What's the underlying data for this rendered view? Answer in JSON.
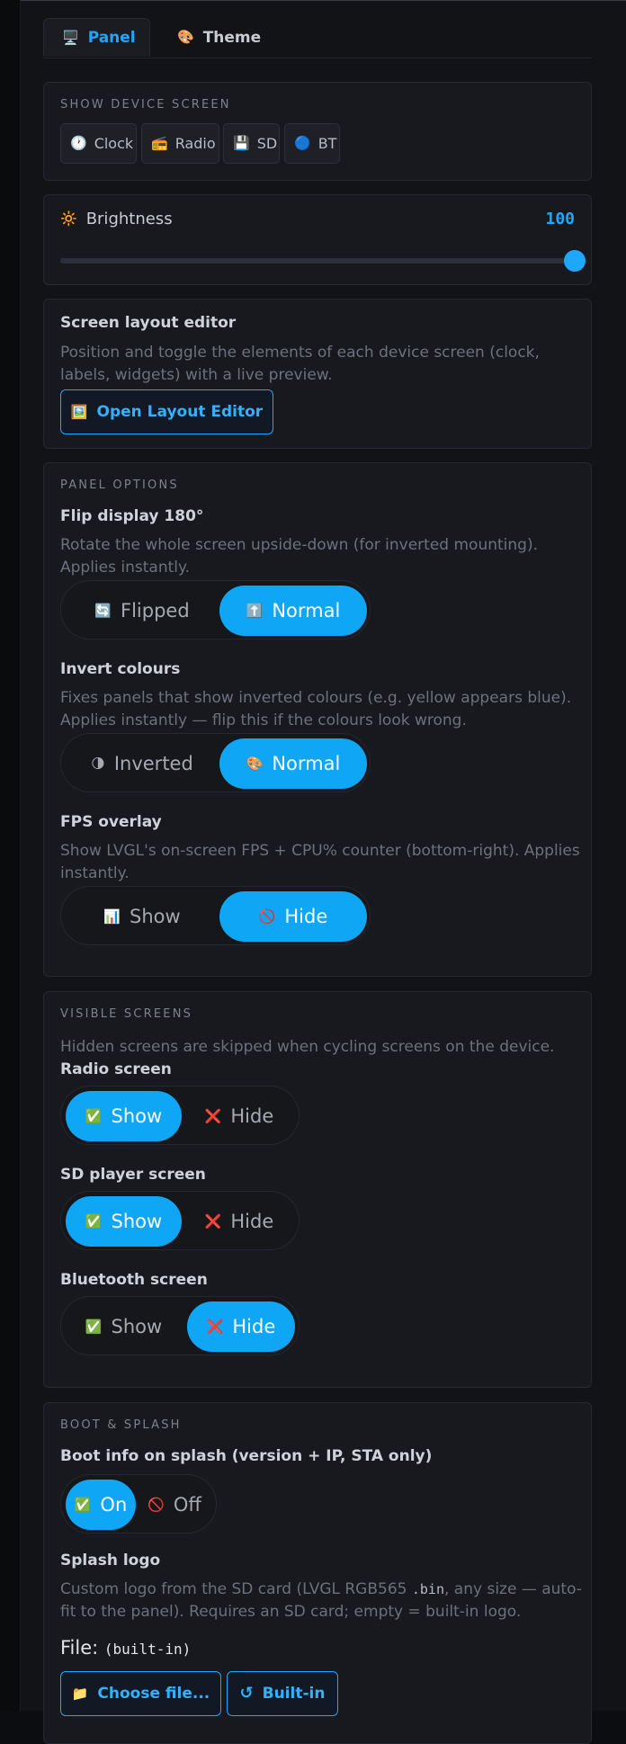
{
  "tabs": [
    {
      "label": "Panel",
      "icon": "monitor-icon",
      "glyph": "🖥️",
      "active": true
    },
    {
      "label": "Theme",
      "icon": "palette-icon",
      "glyph": "🎨",
      "active": false
    }
  ],
  "show_device_screen": {
    "title": "SHOW DEVICE SCREEN",
    "buttons": [
      {
        "label": "Clock",
        "icon": "clock-icon",
        "glyph": "🕐"
      },
      {
        "label": "Radio",
        "icon": "radio-icon",
        "glyph": "📻"
      },
      {
        "label": "SD",
        "icon": "floppy-icon",
        "glyph": "💾"
      },
      {
        "label": "BT",
        "icon": "blue-circle-icon",
        "glyph": "🔵"
      }
    ]
  },
  "brightness": {
    "label": "Brightness",
    "glyph": "🔆",
    "value": "100",
    "min": 0,
    "max": 100,
    "current": 100
  },
  "layout_editor": {
    "title": "Screen layout editor",
    "description": "Position and toggle the elements of each device screen (clock, labels, widgets) with a live preview.",
    "button": "Open Layout Editor",
    "button_glyph": "🖼️"
  },
  "panel_options": {
    "title": "PANEL OPTIONS",
    "flip": {
      "label": "Flip display 180°",
      "description": "Rotate the whole screen upside-down (for inverted mounting). Applies instantly.",
      "options": [
        {
          "label": "Flipped",
          "glyph": "🔄",
          "active": false
        },
        {
          "label": "Normal",
          "glyph": "⬆️",
          "active": true
        }
      ]
    },
    "invert": {
      "label": "Invert colours",
      "description": "Fixes panels that show inverted colours (e.g. yellow appears blue). Applies instantly — flip this if the colours look wrong.",
      "options": [
        {
          "label": "Inverted",
          "glyph": "🌗",
          "active": false
        },
        {
          "label": "Normal",
          "glyph": "🎨",
          "active": true
        }
      ]
    },
    "fps": {
      "label": "FPS overlay",
      "description": "Show LVGL's on-screen FPS + CPU% counter (bottom-right). Applies instantly.",
      "options": [
        {
          "label": "Show",
          "glyph": "📊",
          "active": false
        },
        {
          "label": "Hide",
          "glyph": "🚫",
          "active": true
        }
      ]
    }
  },
  "visible_screens": {
    "title": "VISIBLE SCREENS",
    "description": "Hidden screens are skipped when cycling screens on the device.",
    "radio": {
      "label": "Radio screen",
      "options": [
        {
          "label": "Show",
          "glyph": "✅",
          "active": true
        },
        {
          "label": "Hide",
          "glyph": "❌",
          "active": false
        }
      ]
    },
    "sd": {
      "label": "SD player screen",
      "options": [
        {
          "label": "Show",
          "glyph": "✅",
          "active": true
        },
        {
          "label": "Hide",
          "glyph": "❌",
          "active": false
        }
      ]
    },
    "bt": {
      "label": "Bluetooth screen",
      "options": [
        {
          "label": "Show",
          "glyph": "✅",
          "active": false
        },
        {
          "label": "Hide",
          "glyph": "❌",
          "active": true
        }
      ]
    }
  },
  "boot": {
    "title": "BOOT & SPLASH",
    "info_label": "Boot info on splash (version + IP, STA only)",
    "info_options": [
      {
        "label": "On",
        "glyph": "✅",
        "active": true
      },
      {
        "label": "Off",
        "glyph": "🚫",
        "active": false
      }
    ],
    "logo_label": "Splash logo",
    "logo_desc_before": "Custom logo from the SD card (LVGL RGB565 ",
    "logo_desc_code": ".bin",
    "logo_desc_after": ", any size — auto-fit to the panel). Requires an SD card; empty = built-in logo.",
    "file_label": "File:",
    "file_value": "(built-in)",
    "choose_button": "Choose file...",
    "choose_glyph": "📁",
    "builtin_button": "Built-in",
    "builtin_glyph": "↺"
  },
  "colors": {
    "accent": "#1ea7ff",
    "active_segment": "#0fa6f5",
    "card_bg": "#17191e",
    "page_bg": "#111317"
  }
}
